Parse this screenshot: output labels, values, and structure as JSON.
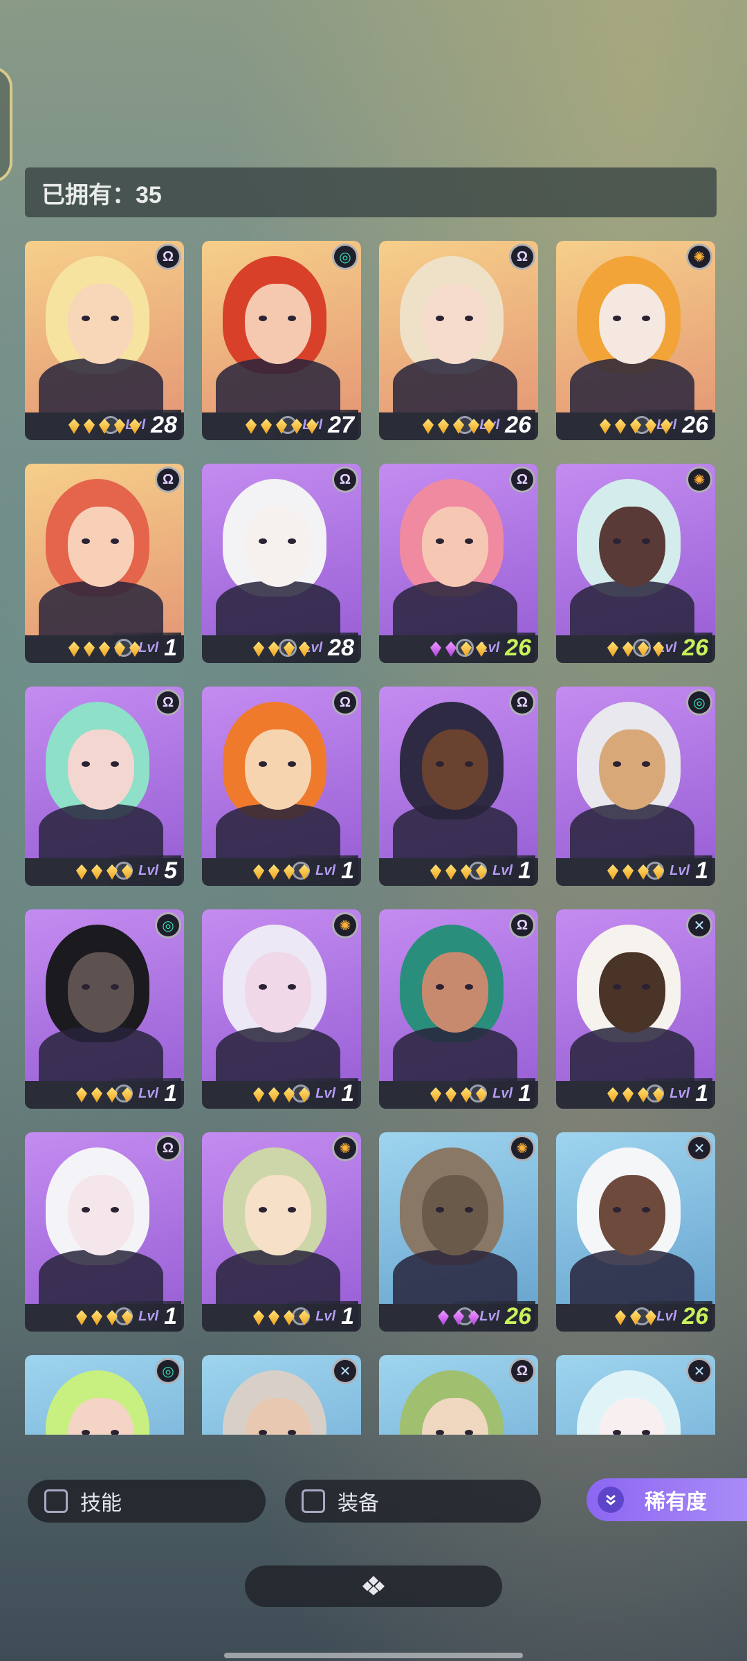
{
  "owned": {
    "label": "已拥有：35"
  },
  "cards": [
    {
      "faction": "omega",
      "bg": "gold",
      "level": "28",
      "level_max": false,
      "gems": 5,
      "gem_color": "gold"
    },
    {
      "faction": "swirl",
      "bg": "gold",
      "level": "27",
      "level_max": false,
      "gems": 5,
      "gem_color": "gold"
    },
    {
      "faction": "omega",
      "bg": "gold",
      "level": "26",
      "level_max": false,
      "gems": 5,
      "gem_color": "gold"
    },
    {
      "faction": "sun",
      "bg": "gold",
      "level": "26",
      "level_max": false,
      "gems": 5,
      "gem_color": "gold"
    },
    {
      "faction": "omega",
      "bg": "gold",
      "level": "1",
      "level_max": false,
      "gems": 5,
      "gem_color": "gold"
    },
    {
      "faction": "omega",
      "bg": "purple",
      "level": "28",
      "level_max": false,
      "gems": 4,
      "gem_color": "gold"
    },
    {
      "faction": "omega",
      "bg": "purple",
      "level": "26",
      "level_max": true,
      "gems": 4,
      "gem_color": "mixed"
    },
    {
      "faction": "sun",
      "bg": "purple",
      "level": "26",
      "level_max": true,
      "gems": 4,
      "gem_color": "gold"
    },
    {
      "faction": "omega",
      "bg": "purple",
      "level": "5",
      "level_max": false,
      "gems": 4,
      "gem_color": "gold"
    },
    {
      "faction": "omega",
      "bg": "purple",
      "level": "1",
      "level_max": false,
      "gems": 4,
      "gem_color": "gold"
    },
    {
      "faction": "omega",
      "bg": "purple",
      "level": "1",
      "level_max": false,
      "gems": 4,
      "gem_color": "gold"
    },
    {
      "faction": "swirl",
      "bg": "purple",
      "level": "1",
      "level_max": false,
      "gems": 4,
      "gem_color": "gold"
    },
    {
      "faction": "swirl",
      "bg": "purple",
      "level": "1",
      "level_max": false,
      "gems": 4,
      "gem_color": "gold"
    },
    {
      "faction": "sun",
      "bg": "purple",
      "level": "1",
      "level_max": false,
      "gems": 4,
      "gem_color": "gold"
    },
    {
      "faction": "omega",
      "bg": "purple",
      "level": "1",
      "level_max": false,
      "gems": 4,
      "gem_color": "gold"
    },
    {
      "faction": "cross",
      "bg": "purple",
      "level": "1",
      "level_max": false,
      "gems": 4,
      "gem_color": "gold"
    },
    {
      "faction": "omega",
      "bg": "purple",
      "level": "1",
      "level_max": false,
      "gems": 4,
      "gem_color": "gold"
    },
    {
      "faction": "sun",
      "bg": "purple",
      "level": "1",
      "level_max": false,
      "gems": 4,
      "gem_color": "gold"
    },
    {
      "faction": "sun",
      "bg": "blue",
      "level": "26",
      "level_max": true,
      "gems": 3,
      "gem_color": "purple"
    },
    {
      "faction": "cross",
      "bg": "blue",
      "level": "26",
      "level_max": true,
      "gems": 3,
      "gem_color": "gold"
    },
    {
      "faction": "swirl",
      "bg": "blue",
      "level": "",
      "level_max": false,
      "gems": 0,
      "gem_color": "gold"
    },
    {
      "faction": "cross",
      "bg": "blue",
      "level": "",
      "level_max": false,
      "gems": 0,
      "gem_color": "gold"
    },
    {
      "faction": "omega",
      "bg": "blue",
      "level": "",
      "level_max": false,
      "gems": 0,
      "gem_color": "gold"
    },
    {
      "faction": "cross",
      "bg": "blue",
      "level": "",
      "level_max": false,
      "gems": 0,
      "gem_color": "gold"
    }
  ],
  "lvl_prefix": "Lvl",
  "filters": {
    "skill_label": "技能",
    "equipment_label": "装备",
    "rarity_label": "稀有度"
  },
  "colors": {
    "accent": "#9b7af5",
    "max_level": "#c8f25a",
    "gem_gold": "#f5c23a",
    "gem_purple": "#d06af0"
  }
}
